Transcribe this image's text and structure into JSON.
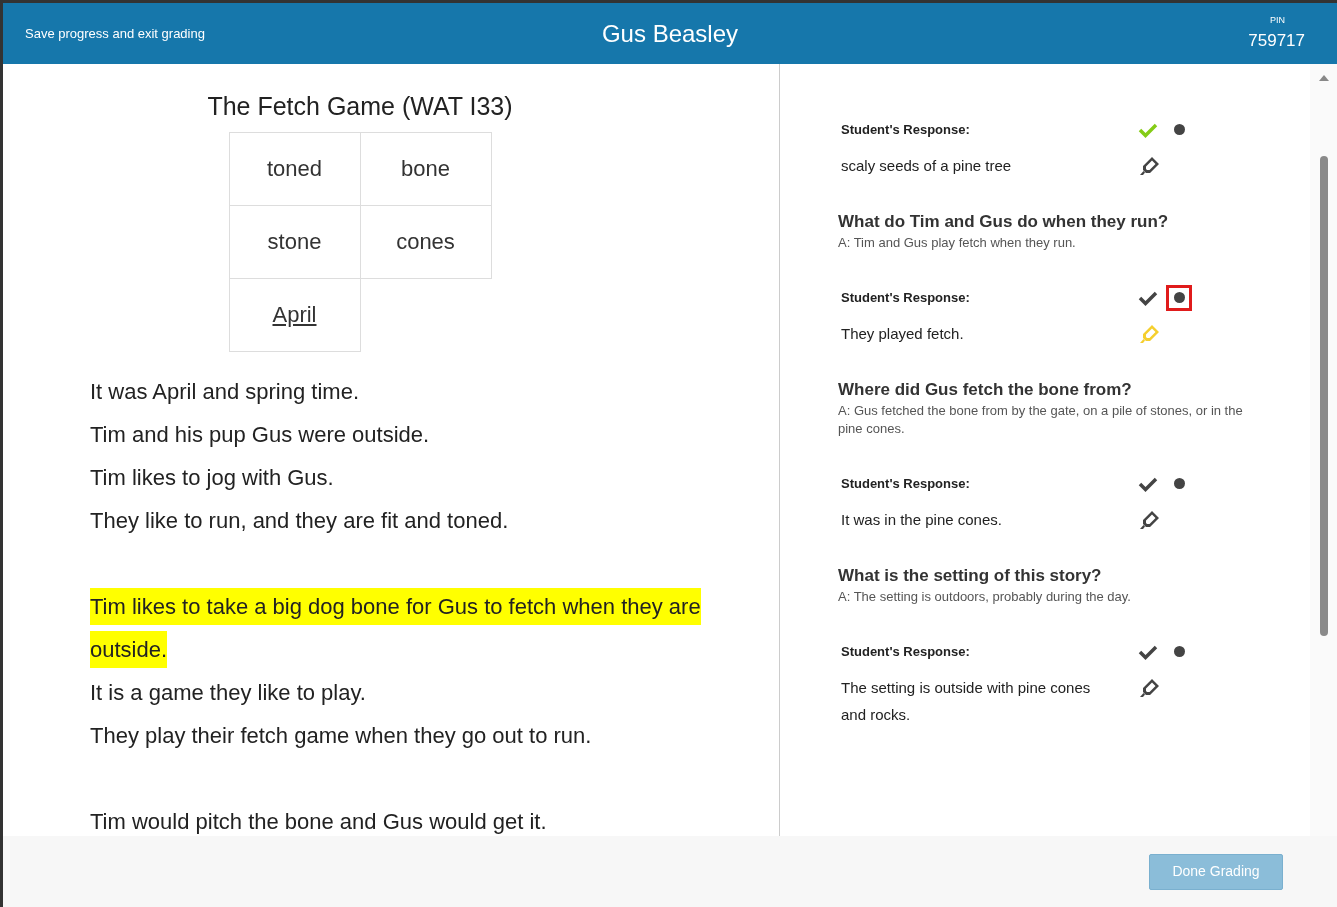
{
  "header": {
    "exit_link": "Save progress and exit grading",
    "student_name": "Gus Beasley",
    "pin_label": "PIN",
    "pin": "759717"
  },
  "passage": {
    "title": "The Fetch Game (WAT I33)",
    "words": [
      {
        "text": "toned",
        "underlined": false
      },
      {
        "text": "bone",
        "underlined": false
      },
      {
        "text": "stone",
        "underlined": false
      },
      {
        "text": "cones",
        "underlined": false
      },
      {
        "text": "April",
        "underlined": true
      }
    ],
    "paragraphs": [
      [
        {
          "text": "It was April and spring time.",
          "highlighted": false
        },
        {
          "text": "Tim and his pup Gus were outside.",
          "highlighted": false
        },
        {
          "text": "Tim likes to jog with Gus.",
          "highlighted": false
        },
        {
          "text": "They like to run, and they are fit and toned.",
          "highlighted": false
        }
      ],
      [
        {
          "text": "Tim likes to take a big dog bone for Gus to fetch when they are outside.",
          "highlighted": true
        },
        {
          "text": "It is a game they like to play.",
          "highlighted": false
        },
        {
          "text": "They play their fetch game when they go out to run.",
          "highlighted": false
        }
      ],
      [
        {
          "text": "Tim would pitch the bone and Gus would get it.",
          "highlighted": false
        }
      ]
    ]
  },
  "questions": [
    {
      "response_label": "Student's Response:",
      "response": "scaly seeds of a pine tree",
      "correct": true,
      "highlighted": false,
      "focused": false
    },
    {
      "question": "What do Tim and Gus do when they run?",
      "answer": "A: Tim and Gus play fetch when they run.",
      "response_label": "Student's Response:",
      "response": "They played fetch.",
      "correct": false,
      "highlighted": true,
      "focused": true
    },
    {
      "question": "Where did Gus fetch the bone from?",
      "answer": "A: Gus fetched the bone from by the gate, on a pile of stones, or in the pine cones.",
      "response_label": "Student's Response:",
      "response": "It was in the pine cones.",
      "correct": false,
      "highlighted": false,
      "focused": false
    },
    {
      "question": "What is the setting of this story?",
      "answer": "A: The setting is outdoors, probably during the day.",
      "response_label": "Student's Response:",
      "response": "The setting is outside with pine cones and rocks.",
      "correct": false,
      "highlighted": false,
      "focused": false
    }
  ],
  "footer": {
    "done_button": "Done Grading"
  }
}
